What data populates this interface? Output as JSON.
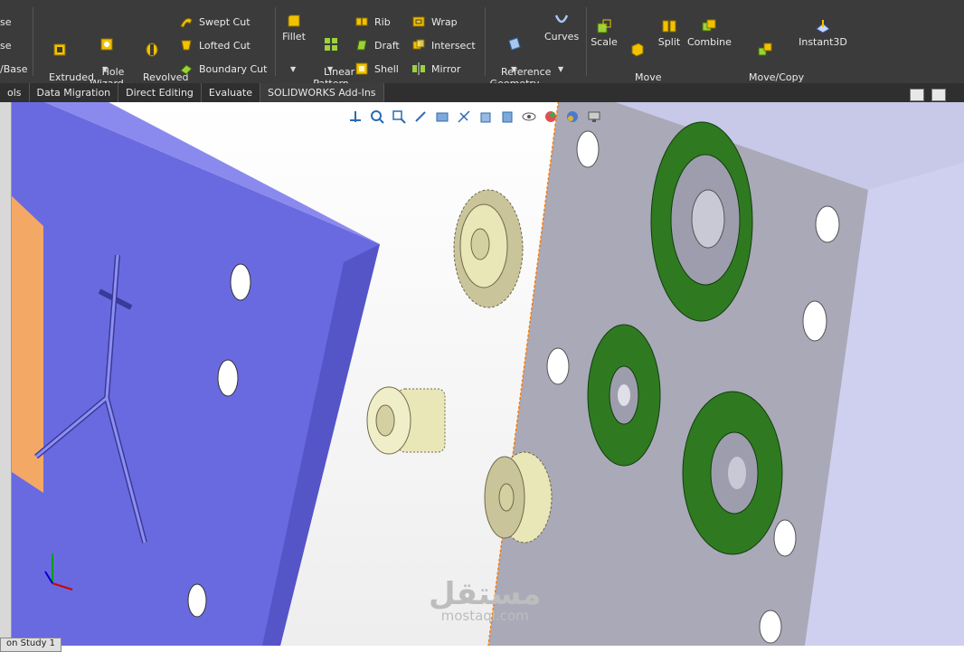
{
  "ribbon": {
    "left_cut": [
      "se",
      "se",
      "/Base"
    ],
    "extruded_cut": "Extruded\nCut",
    "hole_wizard": "Hole\nWizard",
    "revolved_cut": "Revolved\nCut",
    "swept_cut": "Swept Cut",
    "lofted_cut": "Lofted Cut",
    "boundary_cut": "Boundary Cut",
    "fillet": "Fillet",
    "linear_pattern": "Linear\nPattern",
    "rib": "Rib",
    "draft": "Draft",
    "shell": "Shell",
    "wrap": "Wrap",
    "intersect": "Intersect",
    "mirror": "Mirror",
    "reference_geometry": "Reference\nGeometry",
    "curves": "Curves",
    "scale": "Scale",
    "move_face": "Move\nFace",
    "split": "Split",
    "combine": "Combine",
    "move_copy_bodies": "Move/Copy\nBodies",
    "instant3d": "Instant3D"
  },
  "tabs": [
    "ols",
    "Data Migration",
    "Direct Editing",
    "Evaluate",
    "SOLIDWORKS Add-Ins"
  ],
  "bottom_tab": "on Study 1",
  "watermark": {
    "arabic": "مستقل",
    "latin": "mostaql.com"
  },
  "colors": {
    "ribbon_bg": "#3b3b3b",
    "plate_blue": "#6a6ae0",
    "plate_gray": "#a9a9b8",
    "gear_green": "#2f7a21",
    "gear_gold": "#e9e7b7"
  },
  "icons": [
    "view-orientation-icon",
    "zoom-to-fit-icon",
    "zoom-area-icon",
    "previous-view-icon",
    "section-view-icon",
    "dynamic-annotation-icon",
    "view-orientation-cube-icon",
    "display-style-icon",
    "hide-show-icon",
    "edit-appearance-icon",
    "apply-scene-icon",
    "view-settings-icon"
  ]
}
